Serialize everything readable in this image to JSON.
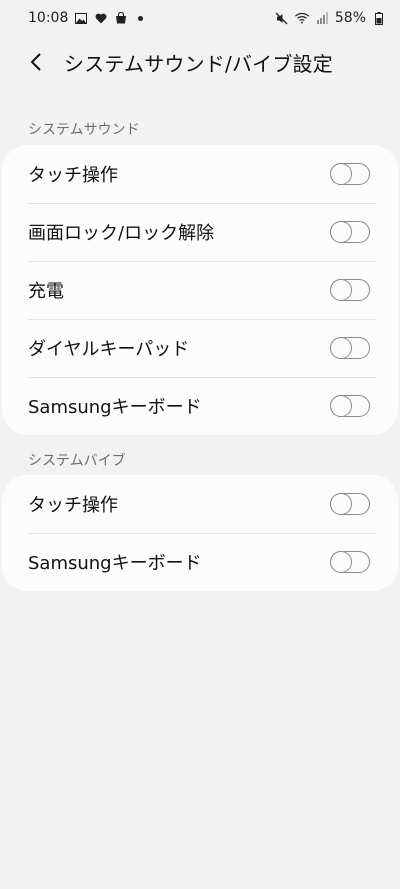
{
  "status_bar": {
    "time": "10:08",
    "battery": "58%",
    "left_icons": [
      "gallery-icon",
      "heart-icon",
      "shopping-bag-icon",
      "notification-dot"
    ],
    "right_icons": [
      "mute-icon",
      "wifi-icon",
      "signal-icon",
      "battery-icon"
    ]
  },
  "header": {
    "title": "システムサウンド/バイブ設定"
  },
  "sections": [
    {
      "title": "システムサウンド",
      "items": [
        {
          "label": "タッチ操作",
          "enabled": false
        },
        {
          "label": "画面ロック/ロック解除",
          "enabled": false
        },
        {
          "label": "充電",
          "enabled": false
        },
        {
          "label": "ダイヤルキーパッド",
          "enabled": false
        },
        {
          "label": "Samsungキーボード",
          "enabled": false
        }
      ]
    },
    {
      "title": "システムバイブ",
      "items": [
        {
          "label": "タッチ操作",
          "enabled": false
        },
        {
          "label": "Samsungキーボード",
          "enabled": false
        }
      ]
    }
  ],
  "colors": {
    "background": "#f2f2f2",
    "card": "#fcfcfc",
    "section_header": "#6d6d6d",
    "toggle_outline": "#8a8a8a"
  }
}
